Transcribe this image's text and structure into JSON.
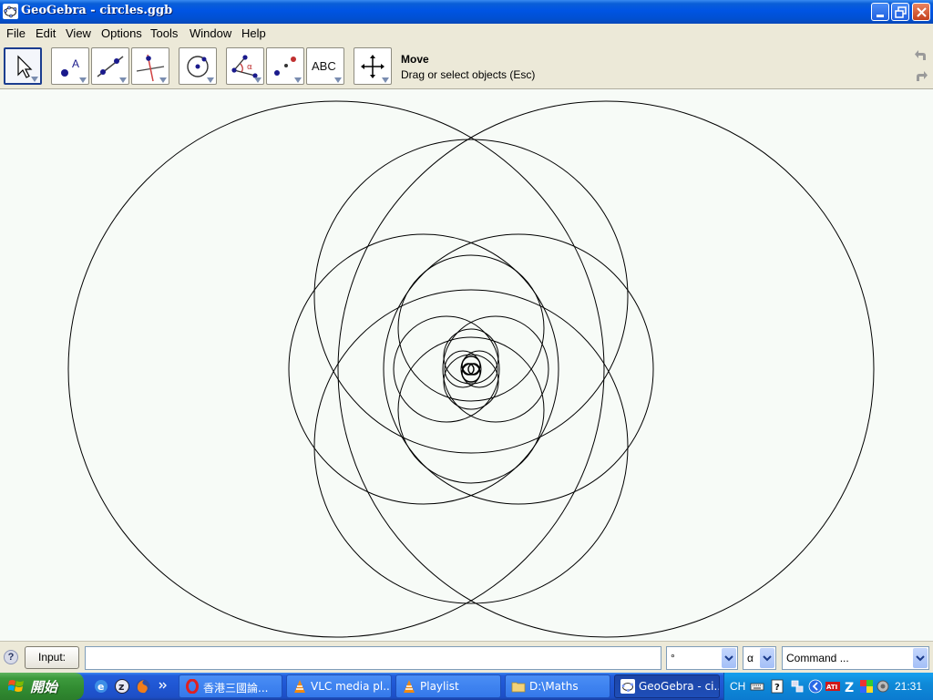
{
  "window": {
    "title": "GeoGebra - circles.ggb"
  },
  "menu": [
    "File",
    "Edit",
    "View",
    "Options",
    "Tools",
    "Window",
    "Help"
  ],
  "toolbar": {
    "tools": [
      {
        "name": "move-tool",
        "icon": "arrow-pointer"
      },
      {
        "name": "point-tool",
        "icon": "point",
        "label": "A"
      },
      {
        "name": "line-tool",
        "icon": "line-through-two-points"
      },
      {
        "name": "perpendicular-line-tool",
        "icon": "perpendicular-line"
      },
      {
        "name": "circle-tool",
        "icon": "circle-with-center"
      },
      {
        "name": "angle-tool",
        "icon": "angle",
        "label": "α"
      },
      {
        "name": "reflect-tool",
        "icon": "reflect-point"
      },
      {
        "name": "text-tool",
        "icon": "text",
        "label": "ABC"
      },
      {
        "name": "move-graphics-tool",
        "icon": "move-arrows"
      }
    ],
    "selected_tool_name": "Move",
    "selected_tool_desc": "Drag or select objects (Esc)"
  },
  "inputbar": {
    "help_icon": "?",
    "input_label": "Input:",
    "input_value": "",
    "degree_combo": "°",
    "alpha_combo": "α",
    "command_combo": "Command ..."
  },
  "taskbar": {
    "start_label": "開始",
    "tasks": [
      {
        "label": "香港三國論...",
        "icon": "opera-icon"
      },
      {
        "label": "VLC media pl...",
        "icon": "vlc-icon"
      },
      {
        "label": "Playlist",
        "icon": "vlc-icon"
      },
      {
        "label": "D:\\Maths",
        "icon": "folder-icon"
      },
      {
        "label": "GeoGebra - ci...",
        "icon": "geogebra-icon",
        "active": true
      }
    ],
    "tray_lang": "CH",
    "clock": "21:31"
  },
  "graphics": {
    "description_colors": {
      "background": "#f7fbf7",
      "stroke": "#000000"
    }
  }
}
